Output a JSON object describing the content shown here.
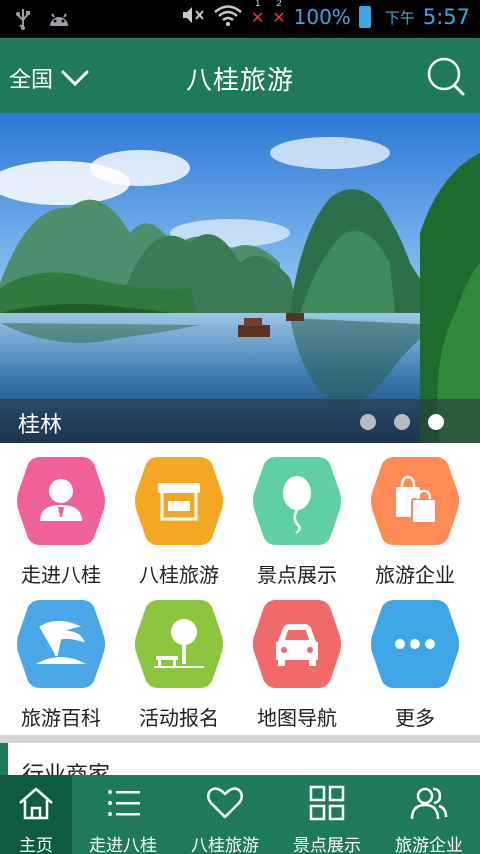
{
  "status_bar": {
    "battery": "100%",
    "ampm": "下午",
    "time": "5:57",
    "sim1": "1",
    "sim2": "2"
  },
  "header": {
    "region": "全国",
    "title": "八桂旅游"
  },
  "banner": {
    "caption": "桂林",
    "page_count": 3,
    "active_index": 2
  },
  "grid": [
    {
      "label": "走进八桂",
      "icon": "person-icon",
      "color": "#f0609a"
    },
    {
      "label": "八桂旅游",
      "icon": "shop-icon",
      "color": "#f5a623"
    },
    {
      "label": "景点展示",
      "icon": "balloon-icon",
      "color": "#5fcfa4"
    },
    {
      "label": "旅游企业",
      "icon": "shopping-bag-icon",
      "color": "#ff8a55"
    },
    {
      "label": "旅游百科",
      "icon": "palm-island-icon",
      "color": "#4aa7e8"
    },
    {
      "label": "活动报名",
      "icon": "tree-bench-icon",
      "color": "#8cc63f"
    },
    {
      "label": "地图导航",
      "icon": "car-icon",
      "color": "#f16a6a"
    },
    {
      "label": "更多",
      "icon": "more-icon",
      "color": "#3fa6e6"
    }
  ],
  "section": {
    "title": "行业商家"
  },
  "bottom_nav": [
    {
      "label": "主页",
      "icon": "home-icon"
    },
    {
      "label": "走进八桂",
      "icon": "list-icon"
    },
    {
      "label": "八桂旅游",
      "icon": "heart-icon"
    },
    {
      "label": "景点展示",
      "icon": "grid-icon"
    },
    {
      "label": "旅游企业",
      "icon": "users-icon"
    }
  ],
  "colors": {
    "brand_green": "#1e7a5a",
    "nav_active": "#0f5c41",
    "status_blue": "#3ba6e0"
  }
}
